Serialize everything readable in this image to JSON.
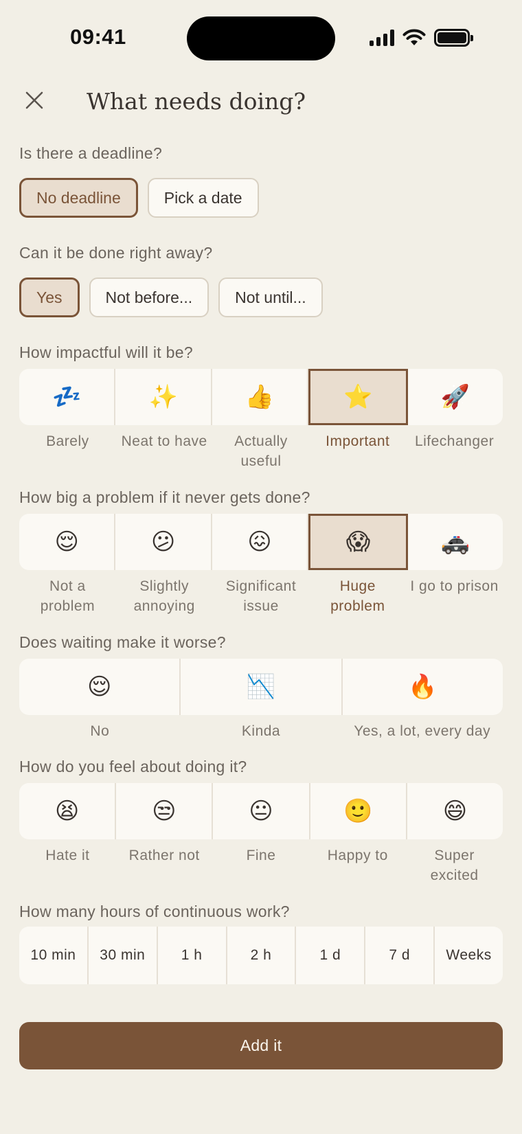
{
  "status_bar": {
    "time": "09:41"
  },
  "header": {
    "title": "What needs doing?"
  },
  "deadline": {
    "label": "Is there a deadline?",
    "options": [
      {
        "label": "No deadline",
        "selected": true
      },
      {
        "label": "Pick a date",
        "selected": false
      }
    ]
  },
  "start": {
    "label": "Can it be done right away?",
    "options": [
      {
        "label": "Yes",
        "selected": true
      },
      {
        "label": "Not before...",
        "selected": false
      },
      {
        "label": "Not until...",
        "selected": false
      }
    ]
  },
  "impact": {
    "label": "How impactful will it be?",
    "options": [
      {
        "icon": "zzz-icon",
        "emoji": "💤",
        "line1": "Barely",
        "line2": ""
      },
      {
        "icon": "sparkles-icon",
        "emoji": "✨",
        "line1": "Neat to have",
        "line2": ""
      },
      {
        "icon": "thumbs-up-icon",
        "emoji": "👍",
        "line1": "Actually",
        "line2": "useful"
      },
      {
        "icon": "star-icon",
        "emoji": "⭐",
        "line1": "Important",
        "line2": ""
      },
      {
        "icon": "rocket-icon",
        "emoji": "🚀",
        "line1": "Lifechanger",
        "line2": ""
      }
    ],
    "selected_index": 3
  },
  "problem": {
    "label": "How big a problem if it never gets done?",
    "options": [
      {
        "icon": "relieved-face-icon",
        "emoji": "😌",
        "line1": "Not a",
        "line2": "problem"
      },
      {
        "icon": "confused-face-icon",
        "emoji": "😕",
        "line1": "Slightly",
        "line2": "annoying"
      },
      {
        "icon": "confounded-face-icon",
        "emoji": "😖",
        "line1": "Significant",
        "line2": "issue"
      },
      {
        "icon": "screaming-face-icon",
        "emoji": "😱",
        "line1": "Huge",
        "line2": "problem"
      },
      {
        "icon": "police-car-icon",
        "emoji": "🚓",
        "line1": "I go to prison",
        "line2": ""
      }
    ],
    "selected_index": 3
  },
  "waiting": {
    "label": "Does waiting make it worse?",
    "options": [
      {
        "icon": "relieved-face-icon",
        "emoji": "😌",
        "line1": "No",
        "line2": ""
      },
      {
        "icon": "chart-decreasing-icon",
        "emoji": "📉",
        "line1": "Kinda",
        "line2": ""
      },
      {
        "icon": "fire-icon",
        "emoji": "🔥",
        "line1": "Yes, a lot, every day",
        "line2": ""
      }
    ],
    "selected_index": -1
  },
  "feeling": {
    "label": "How do you feel about doing it?",
    "options": [
      {
        "icon": "tired-face-icon",
        "emoji": "😫",
        "line1": "Hate it",
        "line2": ""
      },
      {
        "icon": "unamused-face-icon",
        "emoji": "😒",
        "line1": "Rather not",
        "line2": ""
      },
      {
        "icon": "neutral-face-icon",
        "emoji": "😐",
        "line1": "Fine",
        "line2": ""
      },
      {
        "icon": "slight-smile-icon",
        "emoji": "🙂",
        "line1": "Happy to",
        "line2": ""
      },
      {
        "icon": "grinning-face-icon",
        "emoji": "😄",
        "line1": "Super",
        "line2": "excited"
      }
    ],
    "selected_index": -1
  },
  "duration": {
    "label": "How many hours of continuous work?",
    "options": [
      "10 min",
      "30 min",
      "1 h",
      "2 h",
      "1 d",
      "7 d",
      "Weeks"
    ]
  },
  "submit": {
    "label": "Add it"
  },
  "colors": {
    "background": "#f2efe6",
    "accent": "#7a5438",
    "selected_fill": "#e9ddcf",
    "card": "#fbf9f4"
  }
}
